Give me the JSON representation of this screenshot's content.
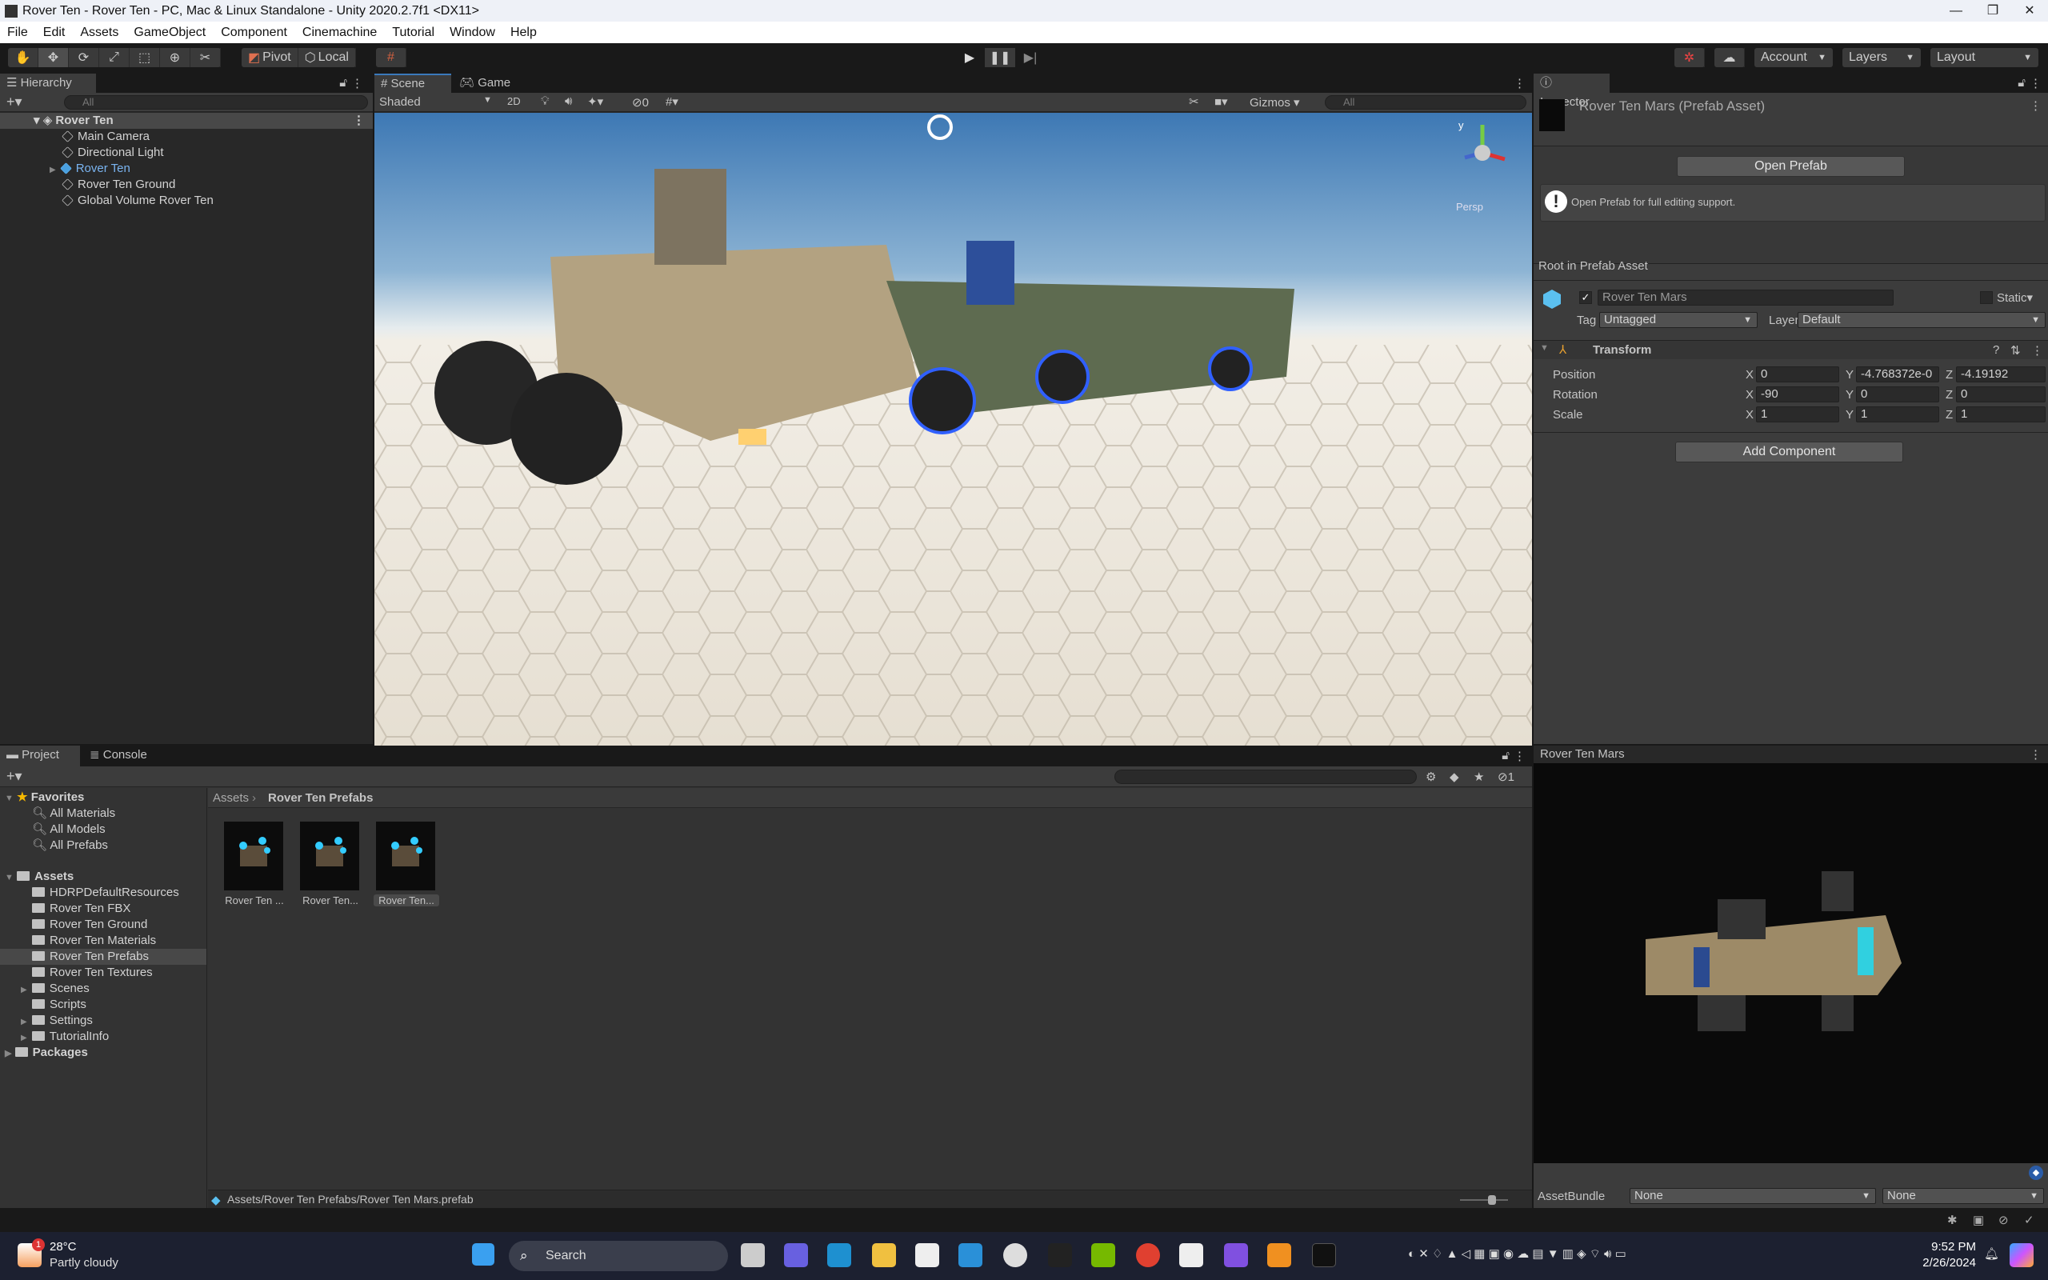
{
  "window": {
    "title": "Rover Ten - Rover Ten - PC, Mac & Linux Standalone - Unity 2020.2.7f1 <DX11>",
    "controls": [
      "—",
      "❐",
      "✕"
    ]
  },
  "menu": [
    "File",
    "Edit",
    "Assets",
    "GameObject",
    "Component",
    "Cinemachine",
    "Tutorial",
    "Window",
    "Help"
  ],
  "toolbar": {
    "pivot": "Pivot",
    "local": "Local",
    "account": "Account",
    "layers": "Layers",
    "layout": "Layout"
  },
  "hierarchy": {
    "tab": "Hierarchy",
    "search_placeholder": "All",
    "scene": "Rover Ten",
    "items": [
      "Main Camera",
      "Directional Light",
      "Rover Ten",
      "Rover Ten Ground",
      "Global Volume Rover Ten"
    ]
  },
  "scene_view": {
    "tabs": [
      "Scene",
      "Game"
    ],
    "shading": "Shaded",
    "mode2d": "2D",
    "hidden_count": "0",
    "gizmos": "Gizmos",
    "search_placeholder": "All",
    "persp": "Persp"
  },
  "inspector": {
    "tab": "Inspector",
    "asset_title": "Rover Ten Mars (Prefab Asset)",
    "open_prefab": "Open Prefab",
    "help_text": "Open Prefab for full editing support.",
    "root_label": "Root in Prefab Asset",
    "name": "Rover Ten Mars",
    "static_label": "Static",
    "tag_label": "Tag",
    "tag": "Untagged",
    "layer_label": "Layer",
    "layer": "Default",
    "transform": {
      "title": "Transform",
      "rows": [
        {
          "label": "Position",
          "x": "0",
          "y": "-4.768372e-0",
          "z": "-4.19192"
        },
        {
          "label": "Rotation",
          "x": "-90",
          "y": "0",
          "z": "0"
        },
        {
          "label": "Scale",
          "x": "1",
          "y": "1",
          "z": "1"
        }
      ]
    },
    "add_component": "Add Component",
    "preview_title": "Rover Ten Mars",
    "assetbundle_label": "AssetBundle",
    "assetbundle": "None",
    "variant": "None"
  },
  "project": {
    "tabs": [
      "Project",
      "Console"
    ],
    "favorites_label": "Favorites",
    "favorites": [
      "All Materials",
      "All Models",
      "All Prefabs"
    ],
    "assets_label": "Assets",
    "folders": [
      {
        "name": "HDRPDefaultResources",
        "arrow": false
      },
      {
        "name": "Rover Ten FBX",
        "arrow": false
      },
      {
        "name": "Rover Ten Ground",
        "arrow": false
      },
      {
        "name": "Rover Ten Materials",
        "arrow": false
      },
      {
        "name": "Rover Ten Prefabs",
        "arrow": false,
        "selected": true
      },
      {
        "name": "Rover Ten Textures",
        "arrow": false
      },
      {
        "name": "Scenes",
        "arrow": true
      },
      {
        "name": "Scripts",
        "arrow": false
      },
      {
        "name": "Settings",
        "arrow": true
      },
      {
        "name": "TutorialInfo",
        "arrow": true
      }
    ],
    "packages_label": "Packages",
    "breadcrumb": [
      "Assets",
      "Rover Ten Prefabs"
    ],
    "assets": [
      "Rover Ten ...",
      "Rover Ten...",
      "Rover Ten..."
    ],
    "hidden_count": "1",
    "path": "Assets/Rover Ten Prefabs/Rover Ten Mars.prefab"
  },
  "taskbar": {
    "weather_temp": "28°C",
    "weather_desc": "Partly cloudy",
    "weather_badge": "1",
    "search": "Search",
    "time": "9:52 PM",
    "date": "2/26/2024"
  }
}
